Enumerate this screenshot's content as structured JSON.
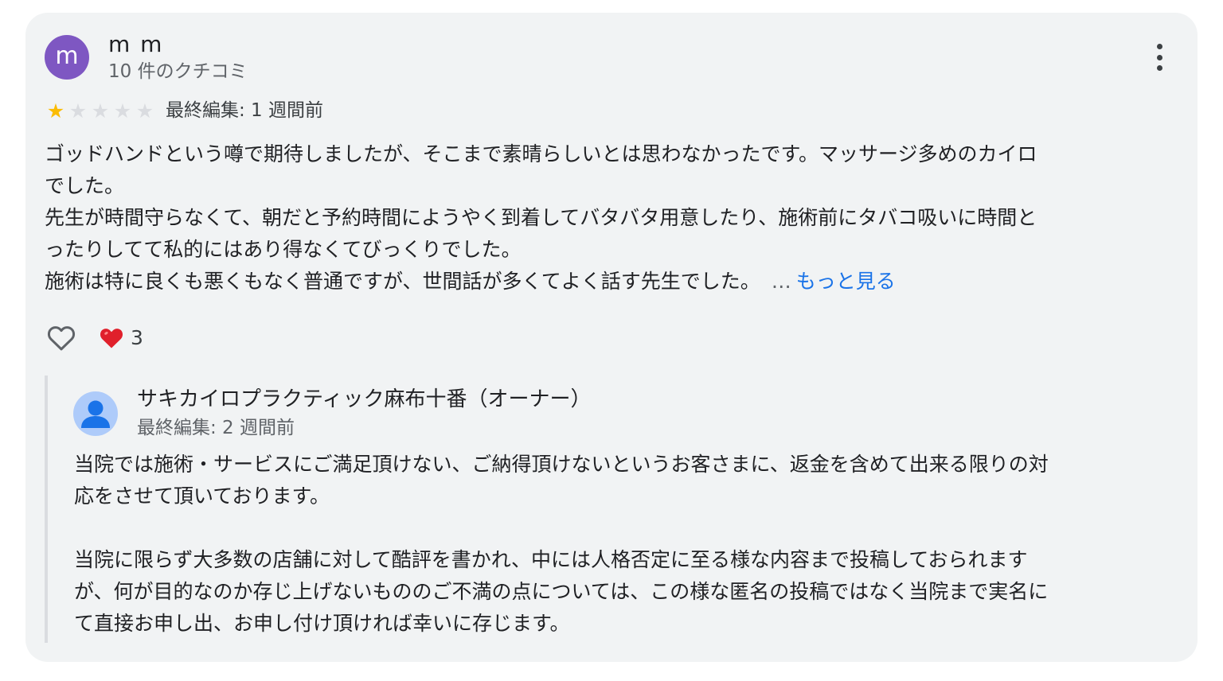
{
  "review": {
    "avatar_letter": "m",
    "avatar_color": "#7e57c2",
    "reviewer_name": "m m",
    "review_count": "10 件のクチコミ",
    "rating": 1,
    "rating_max": 5,
    "star_color": "#fbbc04",
    "edited": "最終編集: 1 週間前",
    "body_lines": [
      "ゴッドハンドという噂で期待しましたが、そこまで素晴らしいとは思わなかったです。マッサージ多めのカイロ",
      "でした。",
      "先生が時間守らなくて、朝だと予約時間にようやく到着してバタバタ用意したり、施術前にタバコ吸いに時間と",
      "ったりしてて私的にはあり得なくてびっくりでした。",
      "施術は特に良くも悪くもなく普通ですが、世間話が多くてよく話す先生でした。"
    ],
    "ellipsis": "…",
    "more_link": "もっと見る",
    "link_color": "#1a73e8",
    "like_icon": "heart-outline-icon",
    "reaction_icon": "red-heart-emoji",
    "reaction_count": "3"
  },
  "owner_reply": {
    "avatar_icon": "person-icon",
    "name": "サキカイロプラクティック麻布十番（オーナー）",
    "edited": "最終編集: 2 週間前",
    "body_lines": [
      "当院では施術・サービスにご満足頂けない、ご納得頂けないというお客さまに、返金を含めて出来る限りの対",
      "応をさせて頂いております。",
      "",
      "当院に限らず大多数の店舗に対して酷評を書かれ、中には人格否定に至る様な内容まで投稿しておられます",
      "が、何が目的なのか存じ上げないもののご不満の点については、この様な匿名の投稿ではなく当院まで実名に",
      "て直接お申し出、お申し付け頂ければ幸いに存じます。"
    ]
  }
}
